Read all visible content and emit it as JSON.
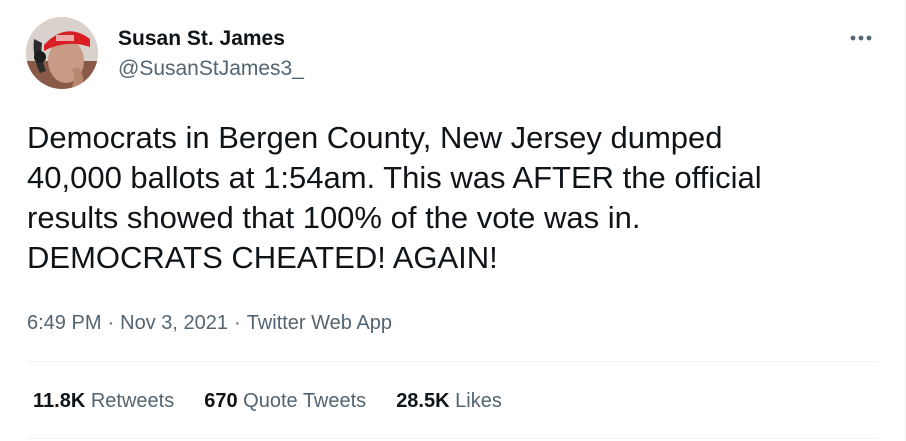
{
  "author": {
    "display_name": "Susan St. James",
    "handle": "@SusanStJames3_"
  },
  "tweet": {
    "text": "Democrats in Bergen County, New Jersey dumped\n40,000 ballots at 1:54am. This was AFTER the official\nresults showed that 100% of the vote was in.\nDEMOCRATS CHEATED! AGAIN!",
    "time": "6:49 PM",
    "separator": "·",
    "date": "Nov 3, 2021",
    "source": "Twitter Web App"
  },
  "stats": {
    "retweets_count": "11.8K",
    "retweets_label": "Retweets",
    "quotes_count": "670",
    "quotes_label": "Quote Tweets",
    "likes_count": "28.5K",
    "likes_label": "Likes"
  },
  "icons": {
    "more": "more-horizontal-icon"
  },
  "colors": {
    "primary_text": "#0f1419",
    "secondary_text": "#536471",
    "divider": "#eff3f4",
    "background": "#ffffff"
  }
}
